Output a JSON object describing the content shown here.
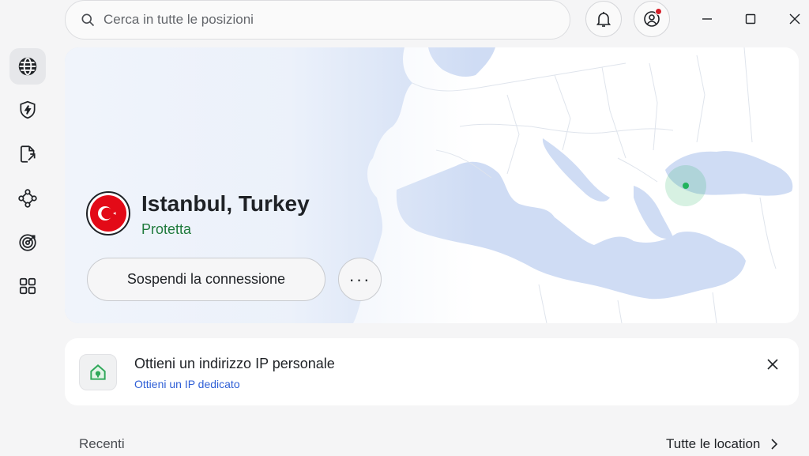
{
  "search": {
    "placeholder": "Cerca in tutte le posizioni"
  },
  "sidebar": {
    "items": [
      {
        "icon": "globe-icon",
        "active": true
      },
      {
        "icon": "shield-bolt-icon",
        "active": false
      },
      {
        "icon": "file-share-icon",
        "active": false
      },
      {
        "icon": "mesh-network-icon",
        "active": false
      },
      {
        "icon": "target-icon",
        "active": false
      },
      {
        "icon": "apps-grid-icon",
        "active": false
      }
    ]
  },
  "header": {
    "notification_icon": "bell-icon",
    "profile_icon": "user-circle-icon"
  },
  "connection": {
    "location": "Istanbul, Turkey",
    "status": "Protetta",
    "pause_label": "Sospendi la connessione",
    "more_label": "···"
  },
  "promo": {
    "title": "Ottieni un indirizzo IP personale",
    "link": "Ottieni un IP dedicato"
  },
  "recent": {
    "label": "Recenti",
    "all_locations": "Tutte le location"
  },
  "colors": {
    "accent_green": "#1f7a3c",
    "link_blue": "#2f5fd6",
    "water": "#cfdcf4",
    "marker": "#22b35e"
  }
}
